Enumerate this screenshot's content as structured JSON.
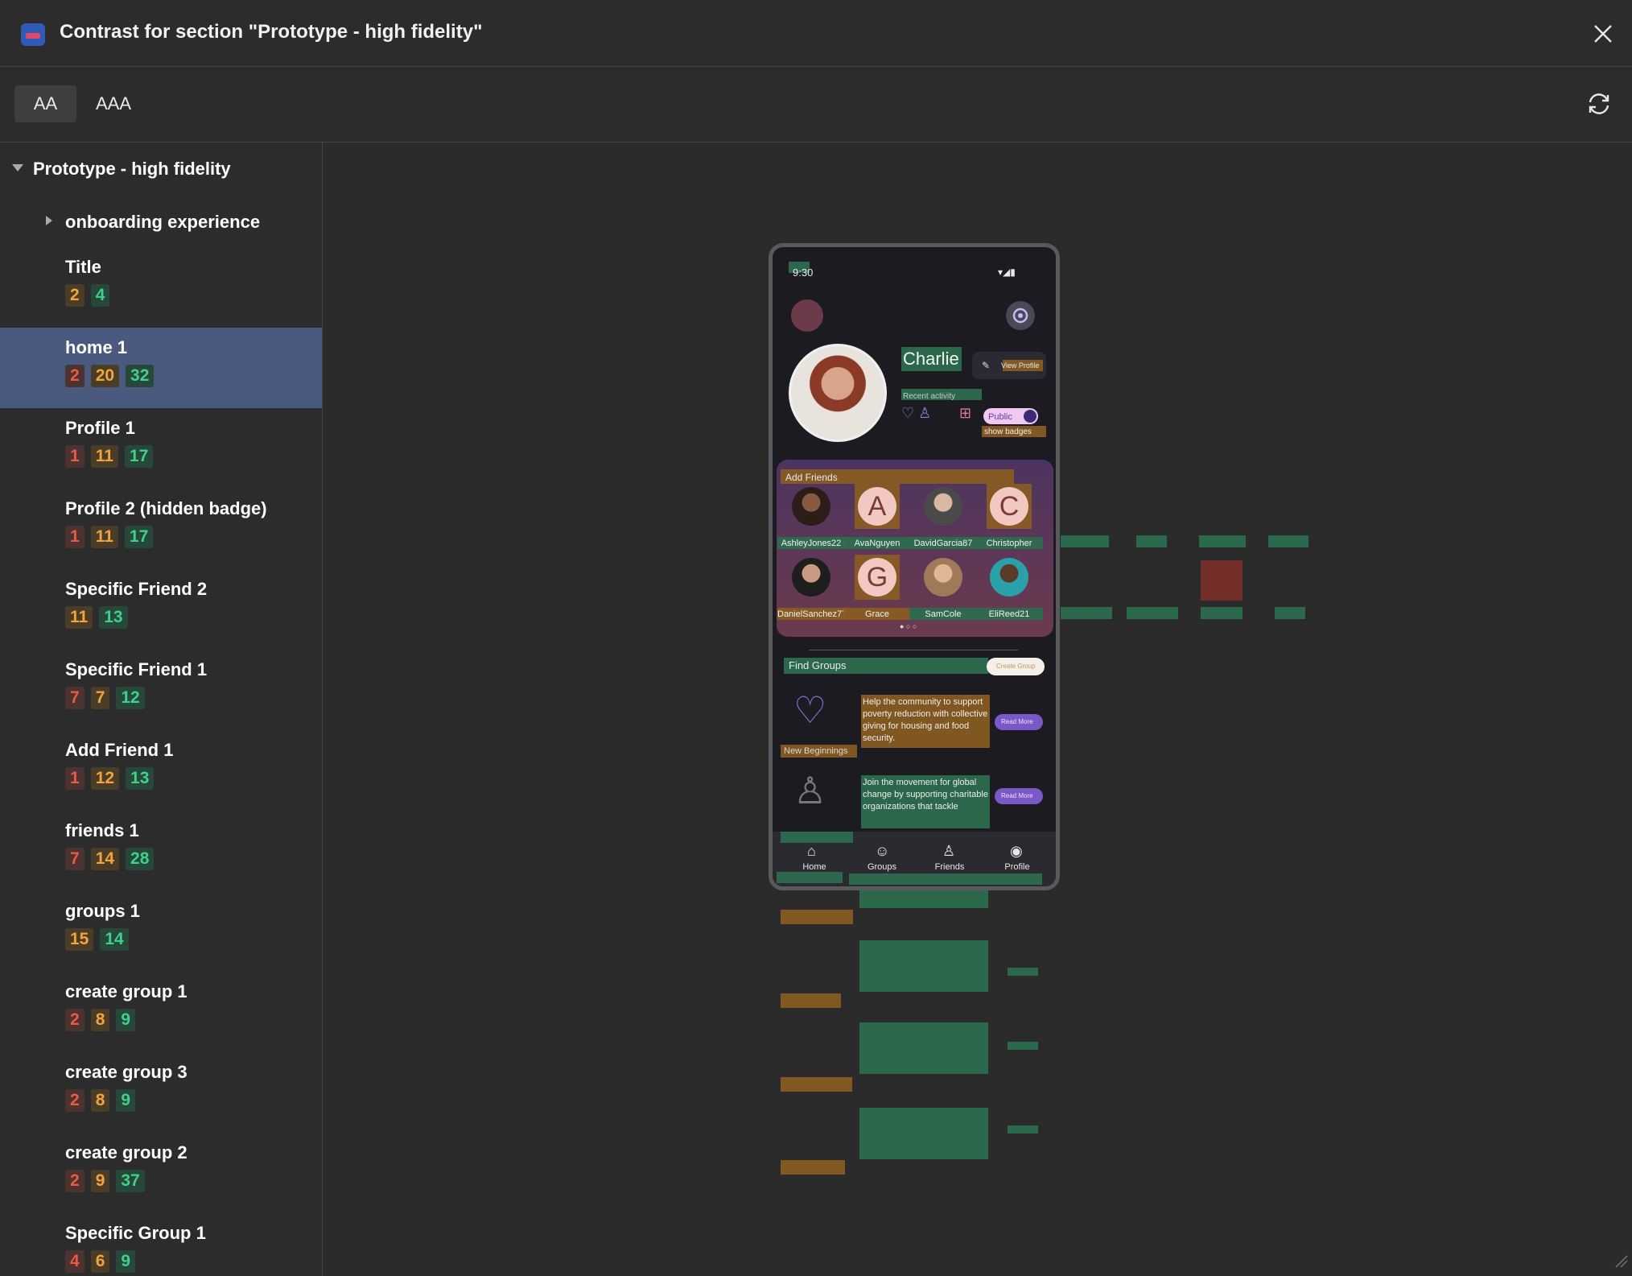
{
  "window": {
    "title": "Contrast for section \"Prototype - high fidelity\"",
    "close_icon": "close-icon",
    "app_icon": "plugin-app-icon"
  },
  "tabs": [
    {
      "label": "AA",
      "selected": true
    },
    {
      "label": "AAA",
      "selected": false
    }
  ],
  "refresh_icon": "refresh-icon",
  "sidebar": {
    "root_label": "Prototype - high fidelity",
    "group_label": "onboarding experience",
    "items": [
      {
        "name": "Title",
        "badges": [
          {
            "value": "2",
            "level": "orange"
          },
          {
            "value": "4",
            "level": "green"
          }
        ]
      },
      {
        "name": "home 1",
        "badges": [
          {
            "value": "2",
            "level": "red"
          },
          {
            "value": "20",
            "level": "orange"
          },
          {
            "value": "32",
            "level": "green"
          }
        ]
      },
      {
        "name": "Profile 1",
        "badges": [
          {
            "value": "1",
            "level": "red"
          },
          {
            "value": "11",
            "level": "orange"
          },
          {
            "value": "17",
            "level": "green"
          }
        ]
      },
      {
        "name": "Profile 2 (hidden badge)",
        "badges": [
          {
            "value": "1",
            "level": "red"
          },
          {
            "value": "11",
            "level": "orange"
          },
          {
            "value": "17",
            "level": "green"
          }
        ]
      },
      {
        "name": "Specific Friend 2",
        "badges": [
          {
            "value": "11",
            "level": "orange"
          },
          {
            "value": "13",
            "level": "green"
          }
        ]
      },
      {
        "name": "Specific Friend 1",
        "badges": [
          {
            "value": "7",
            "level": "red"
          },
          {
            "value": "7",
            "level": "orange"
          },
          {
            "value": "12",
            "level": "green"
          }
        ]
      },
      {
        "name": "Add Friend 1",
        "badges": [
          {
            "value": "1",
            "level": "red"
          },
          {
            "value": "12",
            "level": "orange"
          },
          {
            "value": "13",
            "level": "green"
          }
        ]
      },
      {
        "name": "friends 1",
        "badges": [
          {
            "value": "7",
            "level": "red"
          },
          {
            "value": "14",
            "level": "orange"
          },
          {
            "value": "28",
            "level": "green"
          }
        ]
      },
      {
        "name": "groups 1",
        "badges": [
          {
            "value": "15",
            "level": "orange"
          },
          {
            "value": "14",
            "level": "green"
          }
        ]
      },
      {
        "name": "create group 1",
        "badges": [
          {
            "value": "2",
            "level": "red"
          },
          {
            "value": "8",
            "level": "orange"
          },
          {
            "value": "9",
            "level": "green"
          }
        ]
      },
      {
        "name": "create group 3",
        "badges": [
          {
            "value": "2",
            "level": "red"
          },
          {
            "value": "8",
            "level": "orange"
          },
          {
            "value": "9",
            "level": "green"
          }
        ]
      },
      {
        "name": "create group 2",
        "badges": [
          {
            "value": "2",
            "level": "red"
          },
          {
            "value": "9",
            "level": "orange"
          },
          {
            "value": "37",
            "level": "green"
          }
        ]
      },
      {
        "name": "Specific Group 1",
        "badges": [
          {
            "value": "4",
            "level": "red"
          },
          {
            "value": "6",
            "level": "orange"
          },
          {
            "value": "9",
            "level": "green"
          }
        ]
      }
    ],
    "selected": "home 1"
  },
  "colors": {
    "red": "#ee5a3f",
    "orange": "#f2a33a",
    "green": "#3fd08a",
    "selection": "#495a7e"
  },
  "preview": {
    "status_time": "9:30",
    "user_name": "Charlie",
    "view_profile": "View Profile",
    "recent_activity": "Recent activity",
    "public_label": "Public",
    "show_badges": "show badges",
    "add_friends": "Add Friends",
    "friends": [
      {
        "name": "AshleyJones22",
        "initial": ""
      },
      {
        "name": "AvaNguyen",
        "initial": "A"
      },
      {
        "name": "DavidGarcia87",
        "initial": ""
      },
      {
        "name": "Christopher",
        "initial": "C"
      },
      {
        "name": "DanielSanchez77",
        "initial": ""
      },
      {
        "name": "Grace",
        "initial": "G"
      },
      {
        "name": "SamCole",
        "initial": ""
      },
      {
        "name": "EliReed21",
        "initial": ""
      }
    ],
    "find_groups": "Find Groups",
    "create_group": "Create Group",
    "groups": [
      {
        "name": "New Beginnings",
        "description": "Help the community to support poverty reduction with collective giving for housing and food security.",
        "button": "Read More"
      },
      {
        "name": "",
        "description": "Join the movement for global change by supporting charitable organizations that tackle",
        "button": "Read More"
      }
    ],
    "nav": [
      {
        "label": "Home",
        "icon": "home-icon"
      },
      {
        "label": "Groups",
        "icon": "groups-icon"
      },
      {
        "label": "Friends",
        "icon": "friends-icon"
      },
      {
        "label": "Profile",
        "icon": "profile-icon"
      }
    ]
  }
}
